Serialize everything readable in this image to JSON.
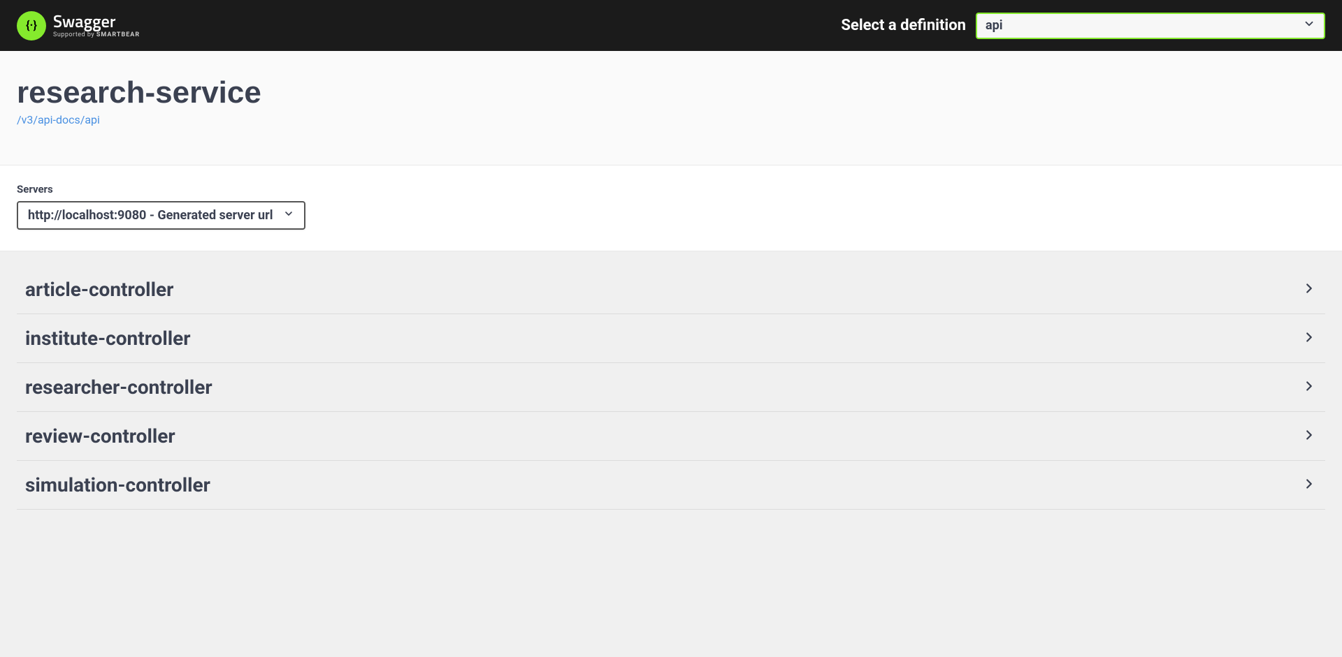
{
  "topbar": {
    "logo_main": "Swagger",
    "logo_sub_prefix": "Supported by ",
    "logo_sub_bold": "SMARTBEAR",
    "definition_label": "Select a definition",
    "definition_selected": "api"
  },
  "info": {
    "title": "research-service",
    "docs_link": "/v3/api-docs/api"
  },
  "servers": {
    "label": "Servers",
    "selected": "http://localhost:9080 - Generated server url"
  },
  "tags": [
    {
      "name": "article-controller"
    },
    {
      "name": "institute-controller"
    },
    {
      "name": "researcher-controller"
    },
    {
      "name": "review-controller"
    },
    {
      "name": "simulation-controller"
    }
  ]
}
